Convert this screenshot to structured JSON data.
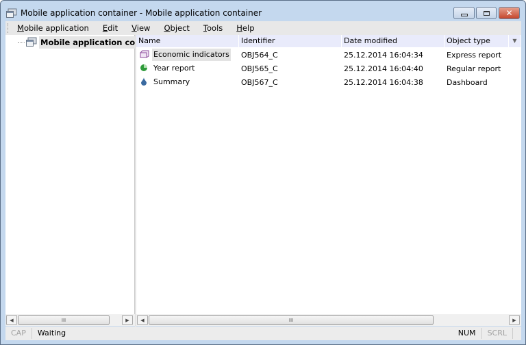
{
  "window": {
    "title": "Mobile application container - Mobile application container",
    "controls": {
      "minimize": "minimize-icon",
      "maximize": "maximize-icon",
      "close": "✕"
    }
  },
  "menu": [
    {
      "label": "Mobile application",
      "key": "M",
      "rest": "obile application"
    },
    {
      "label": "Edit",
      "key": "E",
      "rest": "dit"
    },
    {
      "label": "View",
      "key": "V",
      "rest": "iew"
    },
    {
      "label": "Object",
      "key": "O",
      "rest": "bject"
    },
    {
      "label": "Tools",
      "key": "T",
      "rest": "ools"
    },
    {
      "label": "Help",
      "key": "H",
      "rest": "elp"
    }
  ],
  "tree": {
    "root": "Mobile application container"
  },
  "list": {
    "columns": [
      "Name",
      "Identifier",
      "Date modified",
      "Object type"
    ],
    "rows": [
      {
        "name": "Economic indicators",
        "id": "OBJ564_C",
        "date": "25.12.2014 16:04:34",
        "type": "Express report",
        "icon": "express-report-icon",
        "selected": true
      },
      {
        "name": "Year report",
        "id": "OBJ565_C",
        "date": "25.12.2014 16:04:40",
        "type": "Regular report",
        "icon": "regular-report-icon"
      },
      {
        "name": "Summary",
        "id": "OBJ567_C",
        "date": "25.12.2014 16:04:38",
        "type": "Dashboard",
        "icon": "dashboard-icon"
      }
    ]
  },
  "scroll": {
    "grip": "III",
    "left_arrow": "◀",
    "right_arrow": "▶"
  },
  "status": {
    "cap": "CAP",
    "message": "Waiting",
    "num": "NUM",
    "scrl": "SCRL"
  }
}
